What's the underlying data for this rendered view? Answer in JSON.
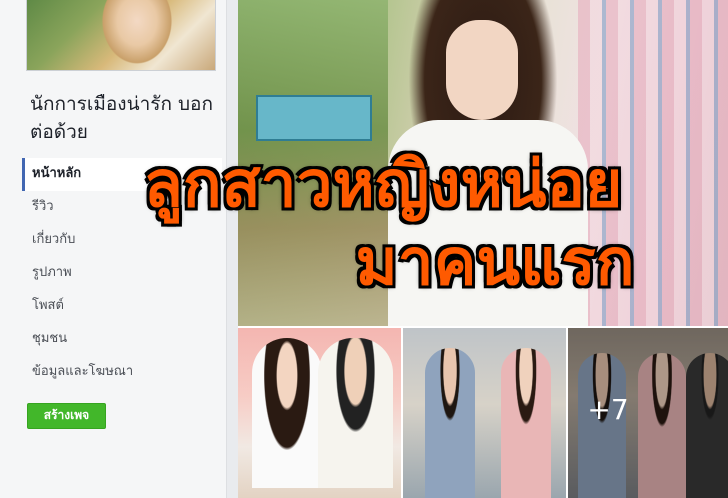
{
  "page": {
    "name": "นักการเมืองน่ารัก บอกต่อด้วย"
  },
  "nav": {
    "items": [
      {
        "label": "หน้าหลัก",
        "active": true
      },
      {
        "label": "รีวิว"
      },
      {
        "label": "เกี่ยวกับ"
      },
      {
        "label": "รูปภาพ"
      },
      {
        "label": "โพสต์"
      },
      {
        "label": "ชุมชน"
      },
      {
        "label": "ข้อมูลและโฆษณา"
      }
    ]
  },
  "create_page_button": "สร้างเพจ",
  "cover_overlay": {
    "line1": "ลูกสาวหญิงหน่อย",
    "line2": "มาคนแรก"
  },
  "thumbnails": {
    "more_count": "+7"
  },
  "colors": {
    "accent": "#4267b2",
    "button_green": "#42b72a",
    "overlay_text": "#ff5a00"
  }
}
